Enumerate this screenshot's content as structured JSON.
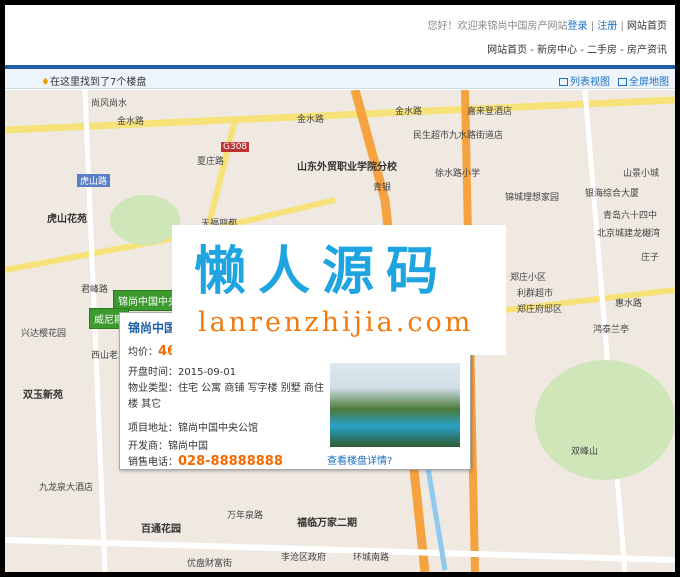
{
  "header": {
    "greeting": "您好！欢迎来锦尚中国房产网站",
    "login": "登录",
    "register": "注册",
    "home": "网站首页",
    "nav": [
      "网站首页",
      "新房中心",
      "二手房",
      "房产资讯"
    ]
  },
  "toolbar": {
    "found": "在这里找到了7个楼盘",
    "list_view": "列表视图",
    "fullscreen": "全屏地图"
  },
  "map": {
    "labels": [
      "尚风尚水",
      "金水路",
      "金水路",
      "金水路",
      "嘉来登酒店",
      "民生超市九水路街道店",
      "山东外贸职业学院分校",
      "虎山路",
      "虎山花苑",
      "天福丽都",
      "徐水路小学",
      "锦城理想家园",
      "银海综合大厦",
      "山景小城",
      "青岛六十四中",
      "北京城建龙樾湾",
      "庄子",
      "郑庄小区",
      "利群超市",
      "郑庄府邸区",
      "鸿泰兰亭",
      "双玉新苑",
      "兴达樱花园",
      "君峰路",
      "西山老主题公",
      "九龙泉大酒店",
      "百通花园",
      "万年泉路",
      "福临万家二期",
      "李沧区政府",
      "环城南路",
      "双峰山",
      "优盘财富街",
      "惠水路",
      "青银",
      "G308",
      "夏庄路"
    ],
    "markers": [
      "锦尚中国中央",
      "威尼斯"
    ]
  },
  "popup": {
    "title": "锦尚中国",
    "price_label": "均价：",
    "price": "46",
    "open_label": "开盘时间：",
    "open": "2015-09-01",
    "type_label": "物业类型：",
    "type": "住宅 公寓 商铺 写字楼 别墅 商住楼 其它",
    "addr_label": "项目地址：",
    "addr": "锦尚中国中央公馆",
    "dev_label": "开发商：",
    "dev": "锦尚中国",
    "tel_label": "销售电话：",
    "tel": "028-88888888",
    "more": "查看楼盘详情?"
  },
  "watermark": {
    "cn": "懒人源码",
    "en": "lanrenzhijia.com"
  }
}
